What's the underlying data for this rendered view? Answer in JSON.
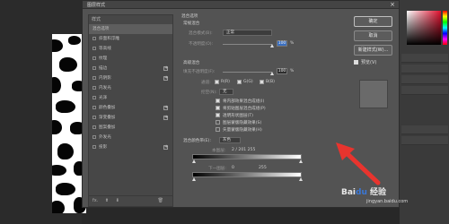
{
  "dialog": {
    "title": "图层样式",
    "close_glyph": "×"
  },
  "style_list": {
    "header": "样式",
    "items": [
      {
        "label": "混合选项",
        "checkbox": false,
        "plus": false,
        "selected": true
      },
      {
        "label": "斜面和浮雕",
        "checkbox": true,
        "plus": false
      },
      {
        "label": "等高线",
        "checkbox": true,
        "plus": false
      },
      {
        "label": "纹理",
        "checkbox": true,
        "plus": false
      },
      {
        "label": "描边",
        "checkbox": true,
        "plus": true
      },
      {
        "label": "内阴影",
        "checkbox": true,
        "plus": true
      },
      {
        "label": "内发光",
        "checkbox": true,
        "plus": false
      },
      {
        "label": "光泽",
        "checkbox": true,
        "plus": false
      },
      {
        "label": "颜色叠加",
        "checkbox": true,
        "plus": true
      },
      {
        "label": "渐变叠加",
        "checkbox": true,
        "plus": true
      },
      {
        "label": "图案叠加",
        "checkbox": true,
        "plus": false
      },
      {
        "label": "外发光",
        "checkbox": true,
        "plus": false
      },
      {
        "label": "投影",
        "checkbox": true,
        "plus": true
      }
    ],
    "bottom_fx": "fx.",
    "bottom_up": "⬆",
    "bottom_down": "⬇",
    "bottom_trash": "🗑"
  },
  "blend": {
    "section_title": "混合选项",
    "general_title": "常规混合",
    "mode_label": "混合模式(B):",
    "mode_value": "正常",
    "opacity_label": "不透明度(O):",
    "opacity_value": "100",
    "opacity_unit": "%",
    "advanced_title": "高级混合",
    "fill_label": "填充不透明度(F):",
    "fill_value": "100",
    "fill_unit": "%",
    "channels_label": "通道:",
    "channel_r": "R(R)",
    "channel_g": "G(G)",
    "channel_b": "B(B)",
    "knockout_label": "挖空(N):",
    "knockout_value": "无",
    "opt1": "将内部效果混合成组(I)",
    "opt2": "将剪贴图层混合成组(P)",
    "opt3": "透明形状图层(T)",
    "opt4": "图层蒙版隐藏效果(S)",
    "opt5": "矢量蒙版隐藏效果(H)",
    "blend_if_label": "混合颜色带(E):",
    "blend_if_value": "灰色",
    "this_layer_label": "本图层:",
    "this_layer_values": "2 / 201  255",
    "underlying_label": "下一图层:",
    "underlying_low": "0",
    "underlying_high": "255"
  },
  "buttons": {
    "ok": "确定",
    "cancel": "取消",
    "new_style": "新建样式(W)...",
    "preview": "预览(V)"
  },
  "watermark": {
    "brand_a": "Bai",
    "brand_paw": "du",
    "brand_b": " 经验",
    "sub": "jingyan.baidu.com"
  },
  "colors": {
    "annotation_arrow": "#e8342e",
    "dialog_bg": "#535353",
    "accent": "#3a6fc0"
  }
}
